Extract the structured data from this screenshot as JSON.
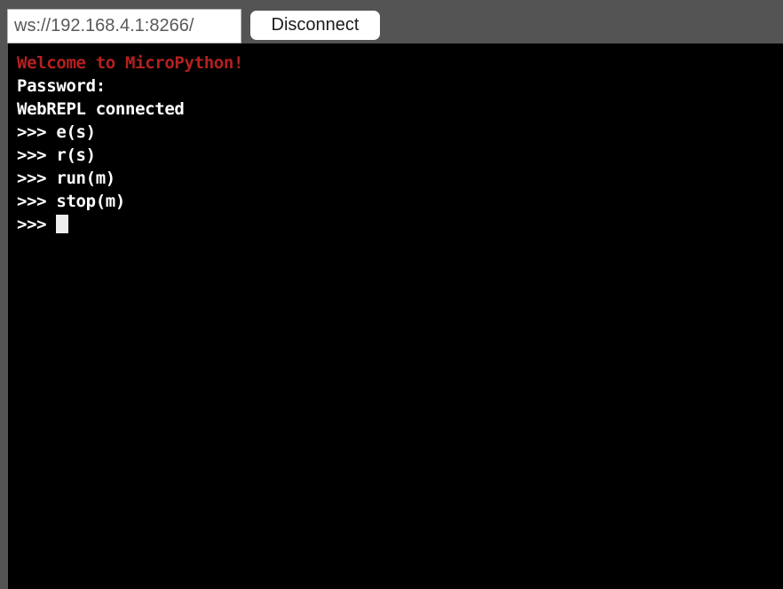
{
  "window": {
    "background_color": "#545454",
    "terminal_background": "#000000"
  },
  "toolbar": {
    "url_field": {
      "value": "ws://192.168.4.1:8266/",
      "placeholder": "ws://192.168.4.1:8266/"
    },
    "disconnect_label": "Disconnect"
  },
  "terminal": {
    "prompt": ">>> ",
    "colors": {
      "banner": "#b42020",
      "text": "#ffffff",
      "cursor": "#eeeeee"
    },
    "lines": [
      {
        "text": "Welcome to MicroPython!",
        "color": "red"
      },
      {
        "text": "Password:",
        "color": "white"
      },
      {
        "text": "WebREPL connected",
        "color": "white"
      },
      {
        "text": ">>> e(s)",
        "color": "white"
      },
      {
        "text": ">>> r(s)",
        "color": "white"
      },
      {
        "text": ">>> run(m)",
        "color": "white"
      },
      {
        "text": ">>> stop(m)",
        "color": "white"
      }
    ],
    "current_line": ">>> ",
    "cursor": "block"
  }
}
